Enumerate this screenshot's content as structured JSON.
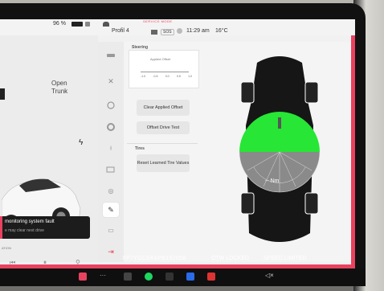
{
  "topbar": {
    "battery": "96 %",
    "profile": "Profil 4",
    "sos": "SOS",
    "time": "11:29 am",
    "temperature": "16°C",
    "service_mode": "SERVICE MODE"
  },
  "left_panel": {
    "trunk_label_line1": "Open",
    "trunk_label_line2": "Trunk",
    "alert_title": "monitoring system fault",
    "alert_subtitle": "e may clear next drive",
    "bottom_label": "ATION"
  },
  "content": {
    "steering_title": "Steering",
    "steering_chart_caption": "Applied Offset",
    "steering_ticks": [
      "-1.0",
      "-0.5",
      "0.0",
      "0.5",
      "1.0"
    ],
    "clear_offset_label": "Clear Applied Offset",
    "offset_drive_test_label": "Offset Drive Test",
    "tires_title": "Tires",
    "reset_tires_label": "Reset Learned Tire Values",
    "torque_readout": "-- Nm"
  },
  "status_bar": {
    "vin": "XP7YGCEK6PB192058",
    "otw": "OTW LOCKED",
    "speed": "SPEED LIMITED"
  },
  "colors": {
    "service_frame": "#e8425f",
    "gauge_green": "#27e635"
  },
  "icons": {
    "nav": [
      "car-icon",
      "wrench-icon",
      "steering-wheel-icon",
      "tire-icon",
      "suspension-icon",
      "battery-icon",
      "brake-icon",
      "pencil-icon",
      "document-icon",
      "exit-icon"
    ]
  }
}
